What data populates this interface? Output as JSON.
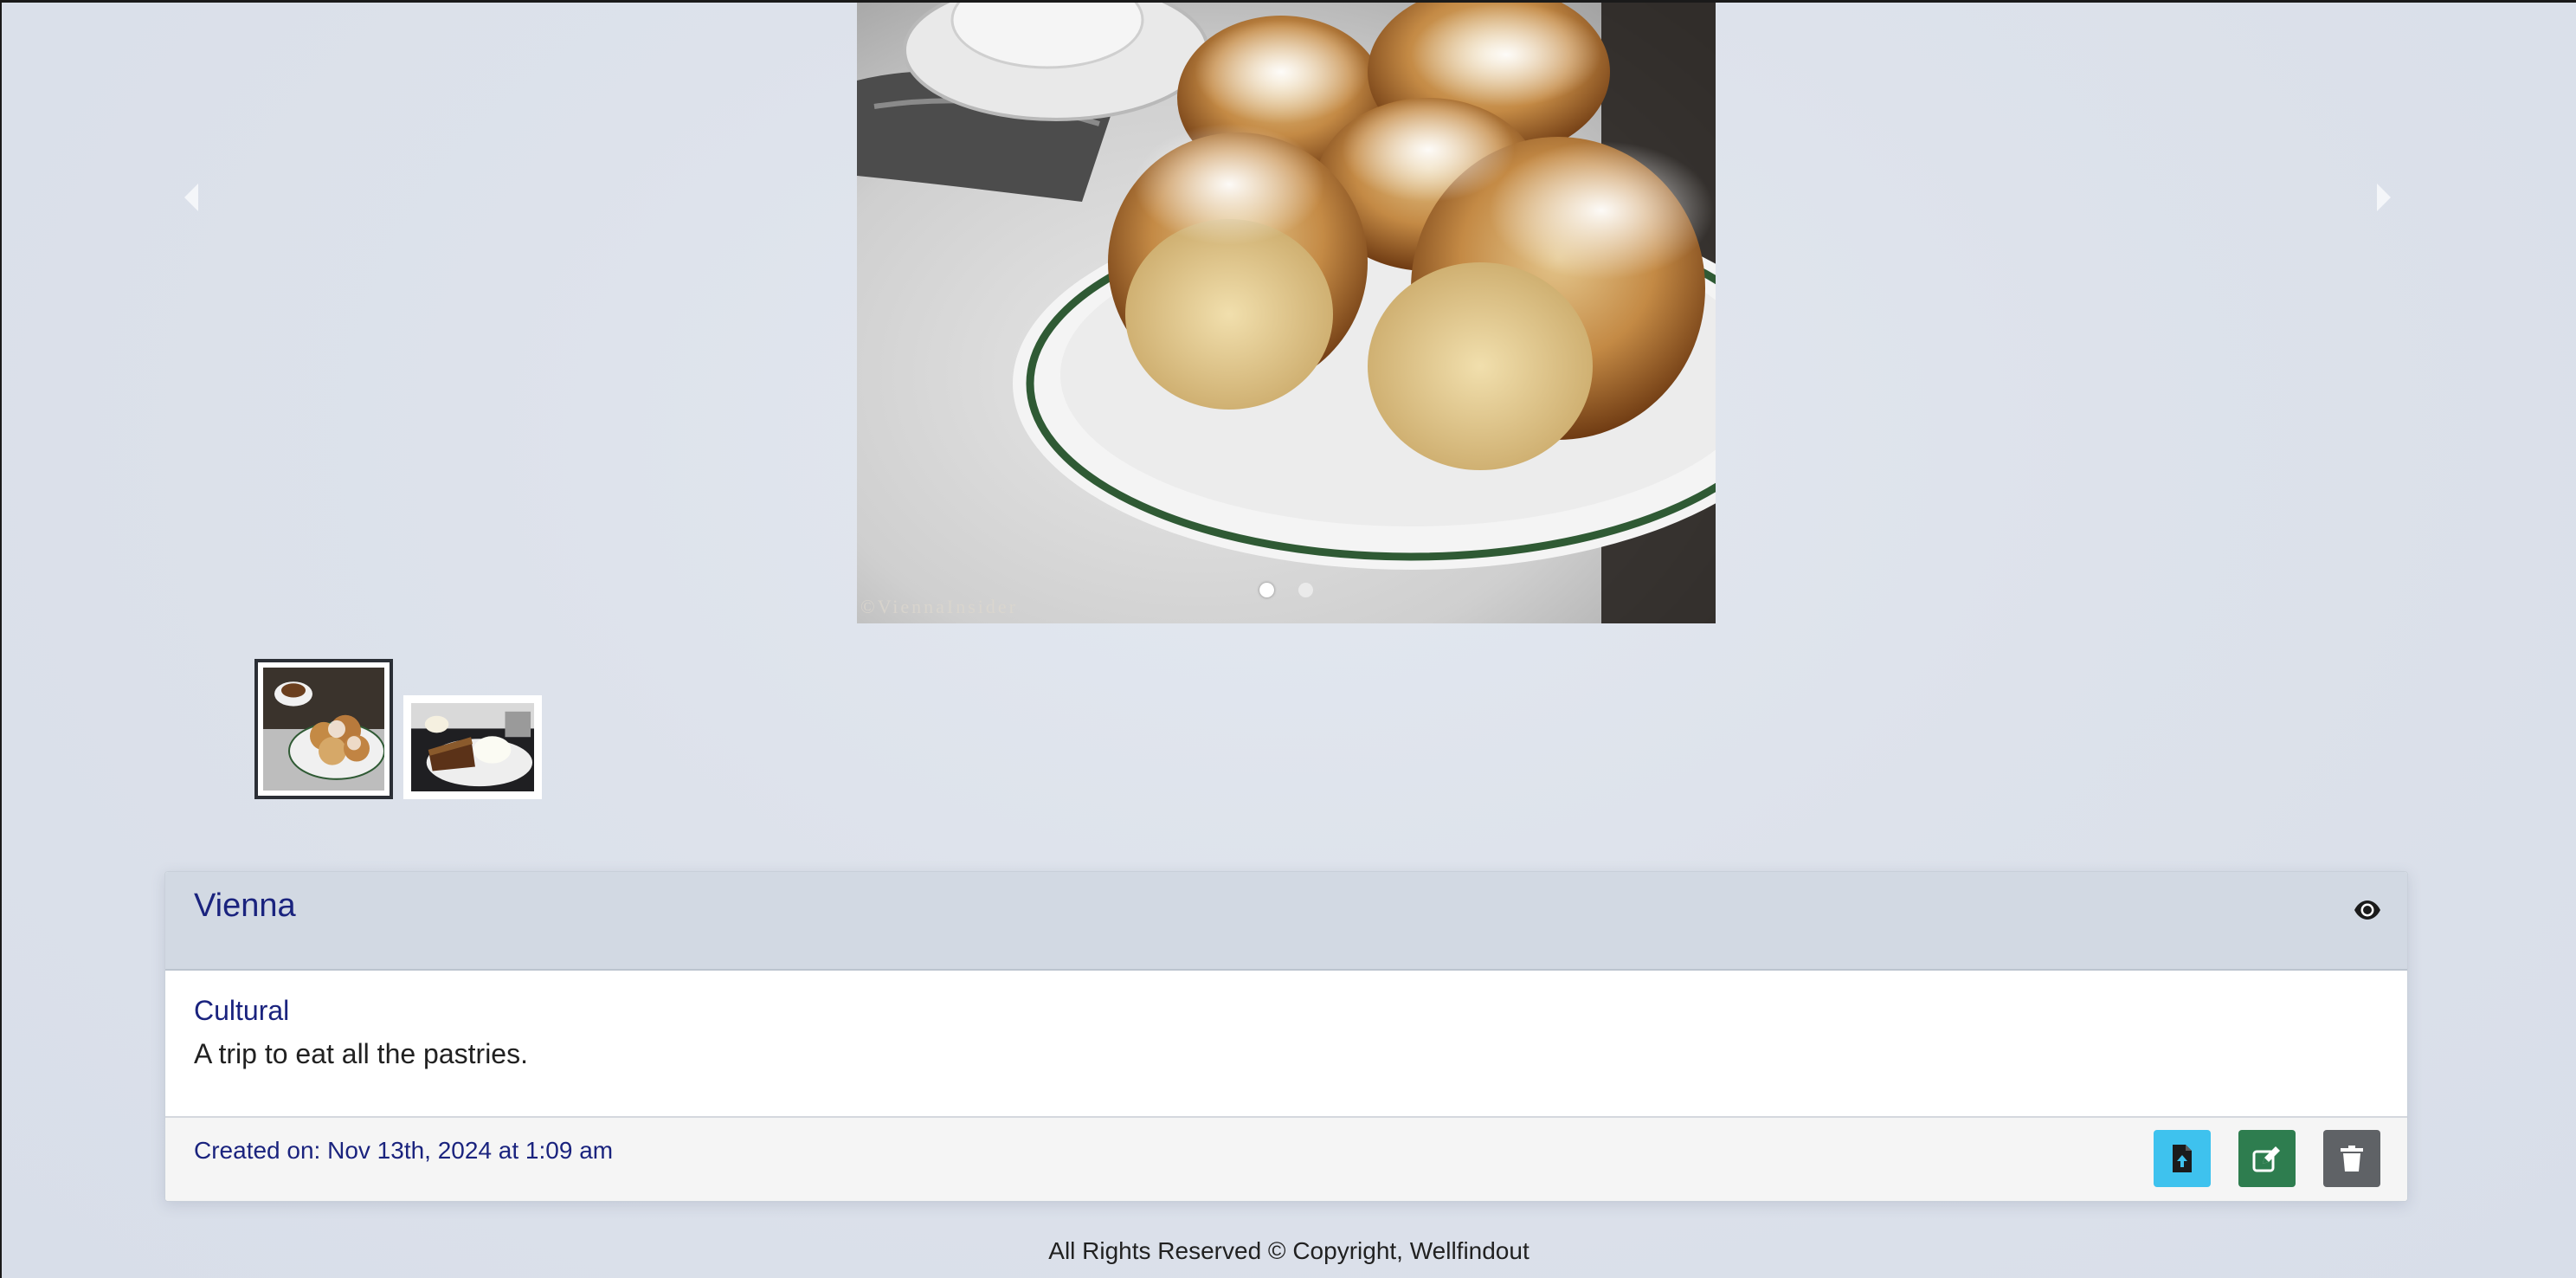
{
  "carousel": {
    "watermark": "©ViennaInsider",
    "slide_count": 2,
    "active_slide": 1,
    "prev_label": "Previous",
    "next_label": "Next"
  },
  "thumbnails": [
    {
      "alt": "Pastries with powdered sugar on a plate",
      "active": true
    },
    {
      "alt": "Cake slice with whipped cream",
      "active": false
    }
  ],
  "trip": {
    "title": "Vienna",
    "category": "Cultural",
    "description": "A trip to eat all the pastries.",
    "created": "Created on: Nov 13th, 2024 at 1:09 am"
  },
  "actions": {
    "upload_icon": "file-upload-icon",
    "edit_icon": "edit-icon",
    "delete_icon": "trash-icon",
    "view_icon": "eye-icon"
  },
  "colors": {
    "title": "#1a237e",
    "upload": "#3ec2ee",
    "edit": "#2e7d4f",
    "delete": "#5f6266"
  },
  "footer": {
    "text": "All Rights Reserved © Copyright, Wellfindout"
  }
}
